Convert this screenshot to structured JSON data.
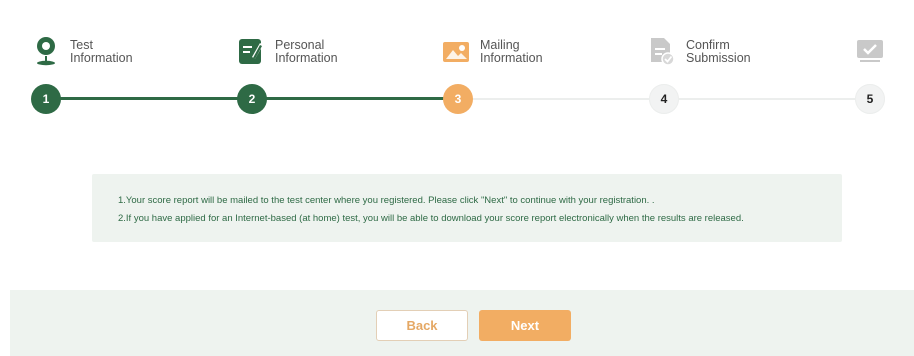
{
  "stepper": {
    "steps": [
      {
        "number": "1",
        "label": "Test\nInformation",
        "icon": "location-pin-icon",
        "state": "done"
      },
      {
        "number": "2",
        "label": "Personal\nInformation",
        "icon": "edit-document-icon",
        "state": "done"
      },
      {
        "number": "3",
        "label": "Mailing\nInformation",
        "icon": "image-mail-icon",
        "state": "active"
      },
      {
        "number": "4",
        "label": "Confirm\nSubmission",
        "icon": "document-check-icon",
        "state": "todo"
      },
      {
        "number": "5",
        "label": "",
        "icon": "monitor-check-icon",
        "state": "todo"
      }
    ]
  },
  "notice": {
    "line1": "1.Your score report will be mailed to the test center where you registered. Please click \"Next\" to continue with your registration. .",
    "line2": "2.If you have applied for an Internet-based (at home) test, you will be able to download your score report electronically when the results are released."
  },
  "footer": {
    "back_label": "Back",
    "next_label": "Next"
  },
  "colors": {
    "done": "#2e6a45",
    "active": "#f2ad63",
    "todo": "#f2f3f3",
    "notice_bg": "#eef3ef"
  }
}
